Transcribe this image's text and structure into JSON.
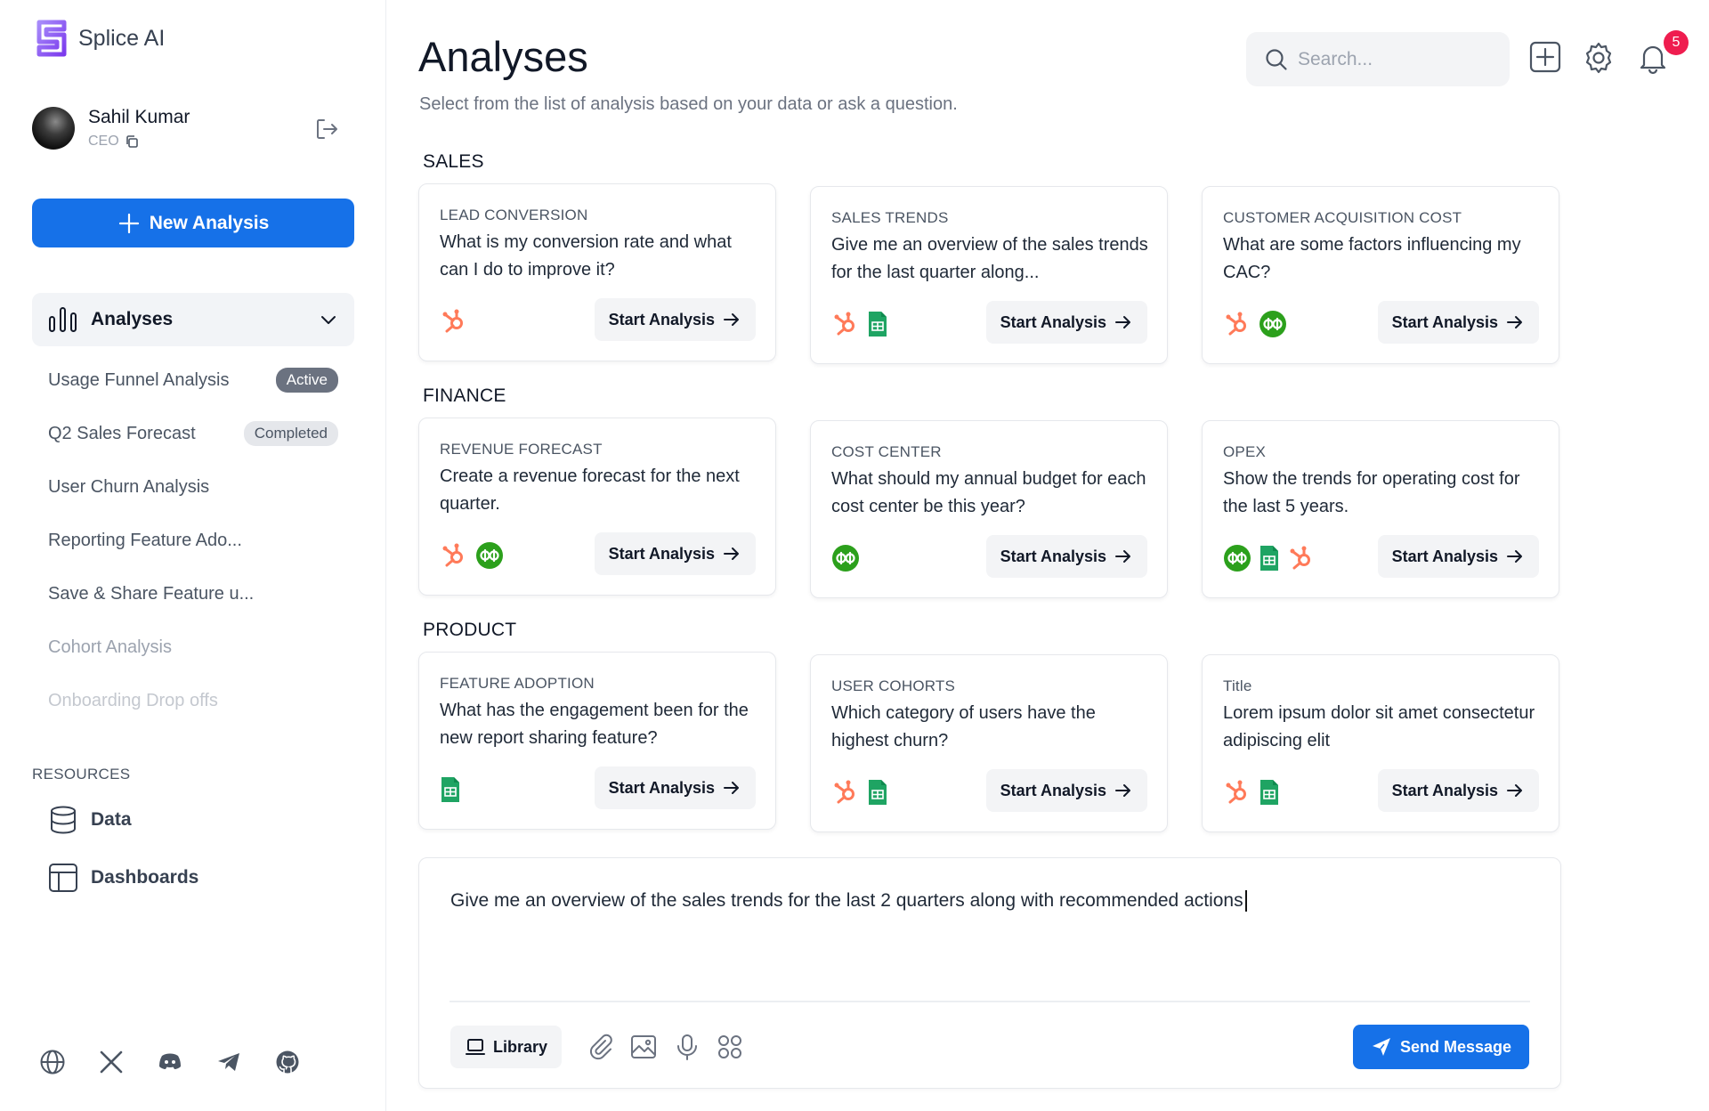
{
  "brand": {
    "name": "Splice AI",
    "color": "#8b5cf6"
  },
  "user": {
    "name": "Sahil Kumar",
    "role": "CEO"
  },
  "sidebar": {
    "new_analysis_label": "New Analysis",
    "analyses_label": "Analyses",
    "items": [
      {
        "label": "Usage Funnel Analysis",
        "badge": "Active",
        "color": "#4b5563"
      },
      {
        "label": "Q2 Sales Forecast",
        "badge": "Completed",
        "color": "#4b5563"
      },
      {
        "label": "User Churn Analysis",
        "badge": "",
        "color": "#4b5563"
      },
      {
        "label": "Reporting Feature Ado...",
        "badge": "",
        "color": "#4b5563"
      },
      {
        "label": "Save & Share Feature u...",
        "badge": "",
        "color": "#4b5563"
      },
      {
        "label": "Cohort Analysis",
        "badge": "",
        "color": "#9ca3af"
      },
      {
        "label": "Onboarding Drop offs",
        "badge": "",
        "color": "#c4c8cf"
      }
    ],
    "resources_title": "RESOURCES",
    "resources": [
      {
        "label": "Data",
        "icon": "database-icon"
      },
      {
        "label": "Dashboards",
        "icon": "dashboard-icon"
      }
    ],
    "social": [
      "globe-icon",
      "x-twitter-icon",
      "discord-icon",
      "telegram-icon",
      "github-icon"
    ]
  },
  "header": {
    "title": "Analyses",
    "subtitle": "Select from the list of analysis based on your data or ask a question.",
    "search_placeholder": "Search...",
    "notification_count": "5"
  },
  "sections": [
    {
      "title": "SALES",
      "cards": [
        {
          "category": "LEAD CONVERSION",
          "question": "What is my conversion rate and what can I do to improve it?",
          "sources": [
            "hubspot"
          ],
          "cta": "Start Analysis"
        },
        {
          "category": "SALES TRENDS",
          "question": "Give me an overview of the sales trends for the last quarter along...",
          "sources": [
            "hubspot",
            "sheets"
          ],
          "cta": "Start Analysis"
        },
        {
          "category": "CUSTOMER ACQUISITION COST",
          "question": "What are some factors influencing my CAC?",
          "sources": [
            "hubspot",
            "quickbooks"
          ],
          "cta": "Start Analysis"
        }
      ]
    },
    {
      "title": "FINANCE",
      "cards": [
        {
          "category": "REVENUE FORECAST",
          "question": "Create a revenue forecast for the next quarter.",
          "sources": [
            "hubspot",
            "quickbooks"
          ],
          "cta": "Start Analysis"
        },
        {
          "category": "COST CENTER",
          "question": "What should my annual budget for each cost center be this year?",
          "sources": [
            "quickbooks"
          ],
          "cta": "Start Analysis"
        },
        {
          "category": "OPEX",
          "question": "Show the trends for operating cost for the last 5 years.",
          "sources": [
            "quickbooks",
            "sheets",
            "hubspot"
          ],
          "cta": "Start Analysis"
        }
      ]
    },
    {
      "title": "PRODUCT",
      "cards": [
        {
          "category": "FEATURE ADOPTION",
          "question": "What has the engagement been for the new report sharing feature?",
          "sources": [
            "sheets"
          ],
          "cta": "Start Analysis"
        },
        {
          "category": "USER COHORTS",
          "question": "Which category of users have the highest churn?",
          "sources": [
            "hubspot",
            "sheets"
          ],
          "cta": "Start Analysis"
        },
        {
          "category": "Title",
          "question": "Lorem ipsum dolor sit amet consectetur adipiscing elit",
          "sources": [
            "hubspot",
            "sheets"
          ],
          "cta": "Start Analysis"
        }
      ]
    }
  ],
  "chat": {
    "text": "Give me an overview of the sales trends for the last 2 quarters along with recommended actions",
    "library_label": "Library",
    "send_label": "Send Message",
    "tools": [
      "paperclip-icon",
      "image-icon",
      "microphone-icon",
      "apps-grid-icon"
    ]
  },
  "colors": {
    "primary": "#1671e8",
    "hubspot": "#ff7a59",
    "quickbooks": "#2ca01c",
    "sheets": "#1fa463",
    "notification": "#ef1d4f"
  }
}
